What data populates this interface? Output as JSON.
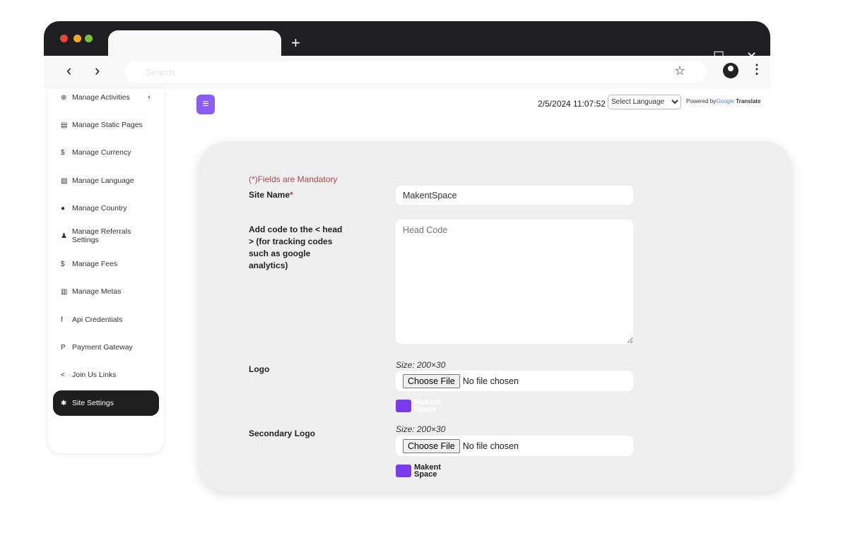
{
  "browser": {
    "search_placeholder": "Search",
    "new_tab": "+",
    "minimize": "—",
    "maximize": "☐",
    "close": "✕",
    "back": "‹",
    "forward": "›",
    "star": "☆",
    "menu": "⋮"
  },
  "sidebar": {
    "items": [
      {
        "label": "Manage Activities",
        "icon": "lifebuoy-icon",
        "glyph": "⊕"
      },
      {
        "label": "Manage Static Pages",
        "icon": "newspaper-icon",
        "glyph": "▤"
      },
      {
        "label": "Manage Currency",
        "icon": "dollar-icon",
        "glyph": "$"
      },
      {
        "label": "Manage Language",
        "icon": "language-icon",
        "glyph": "▧"
      },
      {
        "label": "Manage Country",
        "icon": "globe-icon",
        "glyph": "●"
      },
      {
        "label": "Manage Referrals Settings",
        "icon": "users-icon",
        "glyph": "♟"
      },
      {
        "label": "Manage Fees",
        "icon": "dollar-icon",
        "glyph": "$"
      },
      {
        "label": "Manage Metas",
        "icon": "bar-chart-icon",
        "glyph": "▥"
      },
      {
        "label": "Api Credentials",
        "icon": "facebook-icon",
        "glyph": "f"
      },
      {
        "label": "Payment Gateway",
        "icon": "paypal-icon",
        "glyph": "P"
      },
      {
        "label": "Join Us Links",
        "icon": "share-icon",
        "glyph": "<"
      },
      {
        "label": "Site Settings",
        "icon": "gear-icon",
        "glyph": "✱",
        "active": true
      }
    ]
  },
  "header": {
    "menu_glyph": "≡",
    "datetime": "2/5/2024 11:07:52",
    "language_select": "Select Language",
    "powered_by": "Powered by",
    "google": "Google",
    "translate": "Translate"
  },
  "form": {
    "mandatory_note": "(*)Fields are Mandatory",
    "site_name_label": "Site Name",
    "required_mark": "*",
    "site_name_value": "MakentSpace",
    "head_code_label": "Add code to the < head > (for tracking codes such as google analytics)",
    "head_code_placeholder": "Head Code",
    "logo_label": "Logo",
    "logo_size": "Size: 200×30",
    "choose_file": "Choose File",
    "no_file": "No file chosen",
    "secondary_logo_label": "Secondary Logo",
    "secondary_logo_size": "Size: 200×30",
    "logo_text_1": "Makent",
    "logo_text_2": "Space"
  },
  "colors": {
    "accent": "#8b5cf6",
    "active_bg": "#1e1e1e",
    "mandatory": "#b04a4a"
  }
}
